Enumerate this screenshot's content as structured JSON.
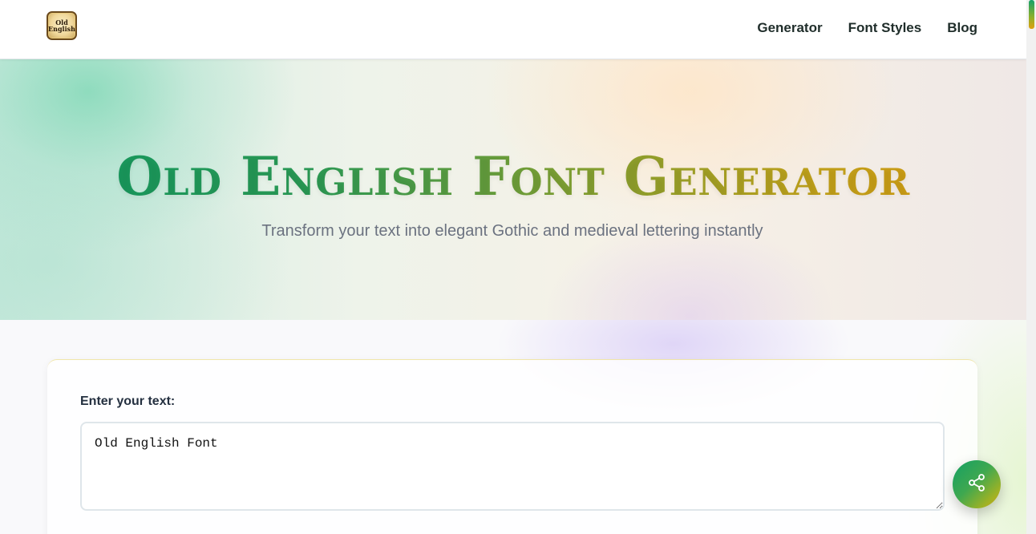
{
  "header": {
    "logo_text_line1": "Old",
    "logo_text_line2": "English",
    "nav": [
      "Generator",
      "Font Styles",
      "Blog"
    ]
  },
  "hero": {
    "title": "Old English Font Generator",
    "subtitle": "Transform your text into elegant Gothic and medieval lettering instantly"
  },
  "editor": {
    "label": "Enter your text:",
    "value": "Old English Font"
  },
  "share_button": {
    "icon": "share-icon"
  },
  "colors": {
    "accent_green": "#0f9a63",
    "accent_gold": "#d9980f"
  }
}
